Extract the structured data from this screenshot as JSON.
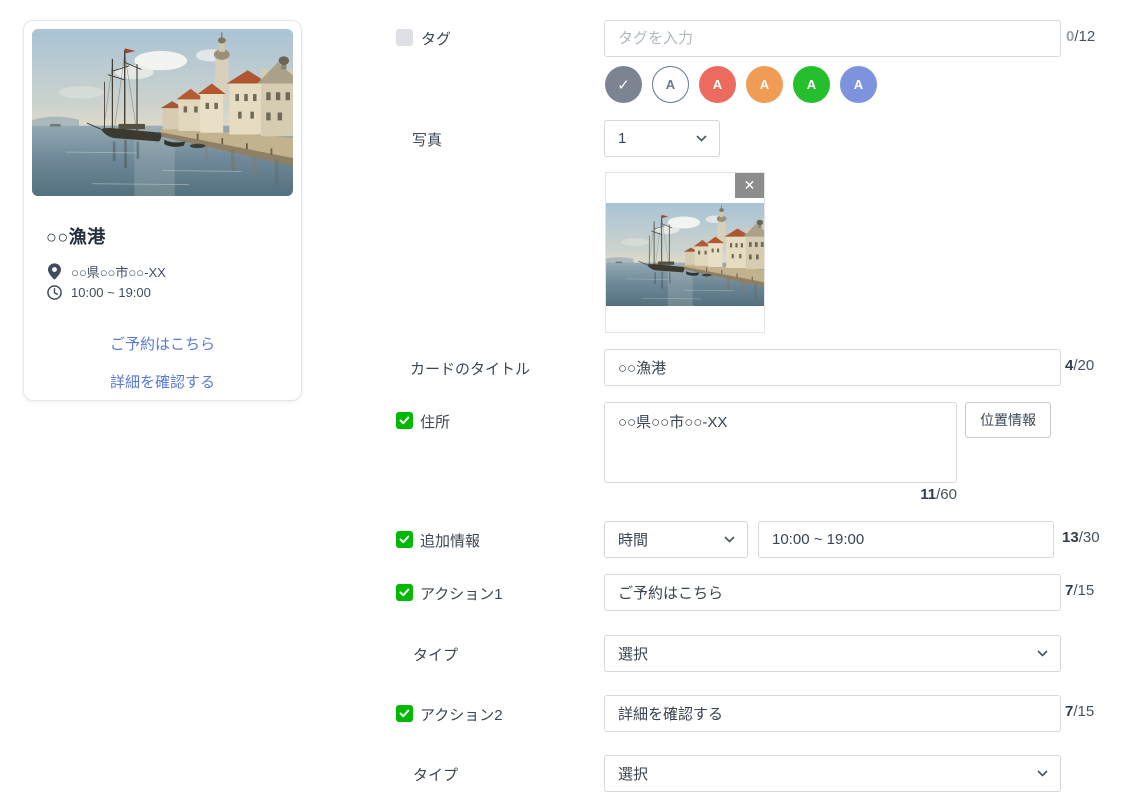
{
  "preview_card": {
    "image": "harbor-town-painting",
    "title": "○○漁港",
    "address": "○○県○○市○○-XX",
    "hours": "10:00 ~ 19:00",
    "action1_label": "ご予約はこちら",
    "action2_label": "詳細を確認する"
  },
  "form": {
    "tag": {
      "label": "タグ",
      "checked": false,
      "placeholder": "タグを入力",
      "count": "0",
      "max": "/12"
    },
    "tag_colors": [
      {
        "name": "default-selected",
        "glyph": "✓",
        "bg": "#7c8494",
        "fg": "#ffffff",
        "border": "",
        "selected": true
      },
      {
        "name": "white",
        "glyph": "A",
        "bg": "#ffffff",
        "fg": "#6e7a88",
        "border": "#66788c",
        "selected": false
      },
      {
        "name": "red",
        "glyph": "A",
        "bg": "#ed6a5e",
        "fg": "#ffffff",
        "border": "",
        "selected": false
      },
      {
        "name": "orange",
        "glyph": "A",
        "bg": "#f09c55",
        "fg": "#ffffff",
        "border": "",
        "selected": false
      },
      {
        "name": "green",
        "glyph": "A",
        "bg": "#25bf2d",
        "fg": "#ffffff",
        "border": "",
        "selected": false
      },
      {
        "name": "blue",
        "glyph": "A",
        "bg": "#7e93de",
        "fg": "#ffffff",
        "border": "",
        "selected": false
      }
    ],
    "photo": {
      "label": "写真",
      "selected_count": "1",
      "close_glyph": "✕"
    },
    "card_title": {
      "label": "カードのタイトル",
      "value": "○○漁港",
      "count": "4",
      "max": "/20"
    },
    "address": {
      "label": "住所",
      "checked": true,
      "value": "○○県○○市○○-XX",
      "location_button": "位置情報",
      "count": "11",
      "max": "/60"
    },
    "extra_info": {
      "label": "追加情報",
      "checked": true,
      "type_value": "時間",
      "value": "10:00 ~ 19:00",
      "count": "13",
      "max": "/30"
    },
    "action1": {
      "label": "アクション1",
      "checked": true,
      "value": "ご予約はこちら",
      "count": "7",
      "max": "/15"
    },
    "type1": {
      "label": "タイプ",
      "value": "選択"
    },
    "action2": {
      "label": "アクション2",
      "checked": true,
      "value": "詳細を確認する",
      "count": "7",
      "max": "/15"
    },
    "type2": {
      "label": "タイプ",
      "value": "選択"
    }
  },
  "colors": {
    "accent_green": "#00b900",
    "link_blue": "#5b7ad6",
    "counter_dark": "#333d49",
    "placeholder_gray": "#b2b8c0"
  }
}
